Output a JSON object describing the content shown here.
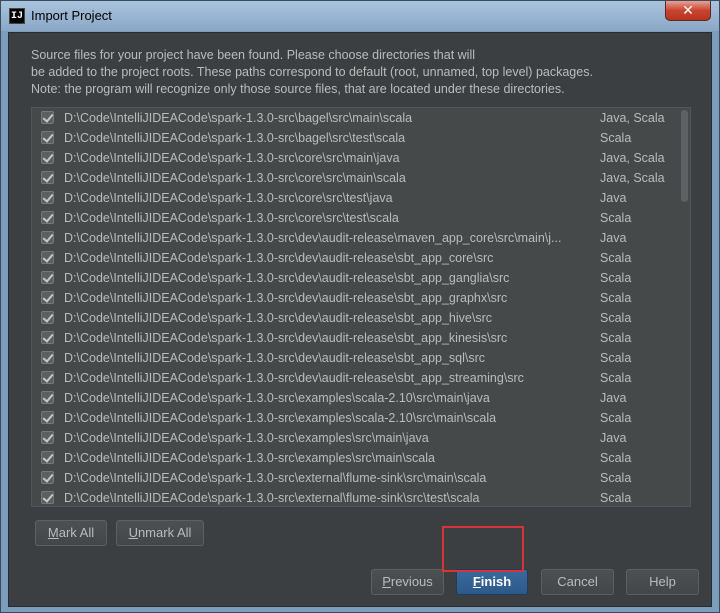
{
  "window": {
    "title": "Import Project",
    "app_icon": "IJ",
    "close_label": "✕"
  },
  "description": [
    "Source files for your project have been found. Please choose directories that will",
    "be added to the project roots. These paths correspond to default (root, unnamed, top level) packages.",
    "Note: the program will recognize only those source files, that are located under these directories."
  ],
  "roots": [
    {
      "path": "D:\\Code\\IntelliJIDEACode\\spark-1.3.0-src\\bagel\\src\\main\\scala",
      "lang": "Java, Scala",
      "checked": true
    },
    {
      "path": "D:\\Code\\IntelliJIDEACode\\spark-1.3.0-src\\bagel\\src\\test\\scala",
      "lang": "Scala",
      "checked": true
    },
    {
      "path": "D:\\Code\\IntelliJIDEACode\\spark-1.3.0-src\\core\\src\\main\\java",
      "lang": "Java, Scala",
      "checked": true
    },
    {
      "path": "D:\\Code\\IntelliJIDEACode\\spark-1.3.0-src\\core\\src\\main\\scala",
      "lang": "Java, Scala",
      "checked": true
    },
    {
      "path": "D:\\Code\\IntelliJIDEACode\\spark-1.3.0-src\\core\\src\\test\\java",
      "lang": "Java",
      "checked": true
    },
    {
      "path": "D:\\Code\\IntelliJIDEACode\\spark-1.3.0-src\\core\\src\\test\\scala",
      "lang": "Scala",
      "checked": true
    },
    {
      "path": "D:\\Code\\IntelliJIDEACode\\spark-1.3.0-src\\dev\\audit-release\\maven_app_core\\src\\main\\j...",
      "lang": "Java",
      "checked": true
    },
    {
      "path": "D:\\Code\\IntelliJIDEACode\\spark-1.3.0-src\\dev\\audit-release\\sbt_app_core\\src",
      "lang": "Scala",
      "checked": true
    },
    {
      "path": "D:\\Code\\IntelliJIDEACode\\spark-1.3.0-src\\dev\\audit-release\\sbt_app_ganglia\\src",
      "lang": "Scala",
      "checked": true
    },
    {
      "path": "D:\\Code\\IntelliJIDEACode\\spark-1.3.0-src\\dev\\audit-release\\sbt_app_graphx\\src",
      "lang": "Scala",
      "checked": true
    },
    {
      "path": "D:\\Code\\IntelliJIDEACode\\spark-1.3.0-src\\dev\\audit-release\\sbt_app_hive\\src",
      "lang": "Scala",
      "checked": true
    },
    {
      "path": "D:\\Code\\IntelliJIDEACode\\spark-1.3.0-src\\dev\\audit-release\\sbt_app_kinesis\\src",
      "lang": "Scala",
      "checked": true
    },
    {
      "path": "D:\\Code\\IntelliJIDEACode\\spark-1.3.0-src\\dev\\audit-release\\sbt_app_sql\\src",
      "lang": "Scala",
      "checked": true
    },
    {
      "path": "D:\\Code\\IntelliJIDEACode\\spark-1.3.0-src\\dev\\audit-release\\sbt_app_streaming\\src",
      "lang": "Scala",
      "checked": true
    },
    {
      "path": "D:\\Code\\IntelliJIDEACode\\spark-1.3.0-src\\examples\\scala-2.10\\src\\main\\java",
      "lang": "Java",
      "checked": true
    },
    {
      "path": "D:\\Code\\IntelliJIDEACode\\spark-1.3.0-src\\examples\\scala-2.10\\src\\main\\scala",
      "lang": "Scala",
      "checked": true
    },
    {
      "path": "D:\\Code\\IntelliJIDEACode\\spark-1.3.0-src\\examples\\src\\main\\java",
      "lang": "Java",
      "checked": true
    },
    {
      "path": "D:\\Code\\IntelliJIDEACode\\spark-1.3.0-src\\examples\\src\\main\\scala",
      "lang": "Scala",
      "checked": true
    },
    {
      "path": "D:\\Code\\IntelliJIDEACode\\spark-1.3.0-src\\external\\flume-sink\\src\\main\\scala",
      "lang": "Scala",
      "checked": true
    },
    {
      "path": "D:\\Code\\IntelliJIDEACode\\spark-1.3.0-src\\external\\flume-sink\\src\\test\\scala",
      "lang": "Scala",
      "checked": true
    }
  ],
  "buttons": {
    "mark_all": {
      "mn": "M",
      "rest": "ark All"
    },
    "unmark_all": {
      "mn": "U",
      "rest": "nmark All"
    },
    "previous": {
      "mn": "P",
      "rest": "revious"
    },
    "finish": {
      "mn": "F",
      "rest": "inish"
    },
    "cancel": "Cancel",
    "help": "Help"
  },
  "colors": {
    "dialog_bg": "#3c3f41",
    "list_bg": "#45494a",
    "primary_button": "#2d5988",
    "highlight_box": "#d9323a"
  }
}
